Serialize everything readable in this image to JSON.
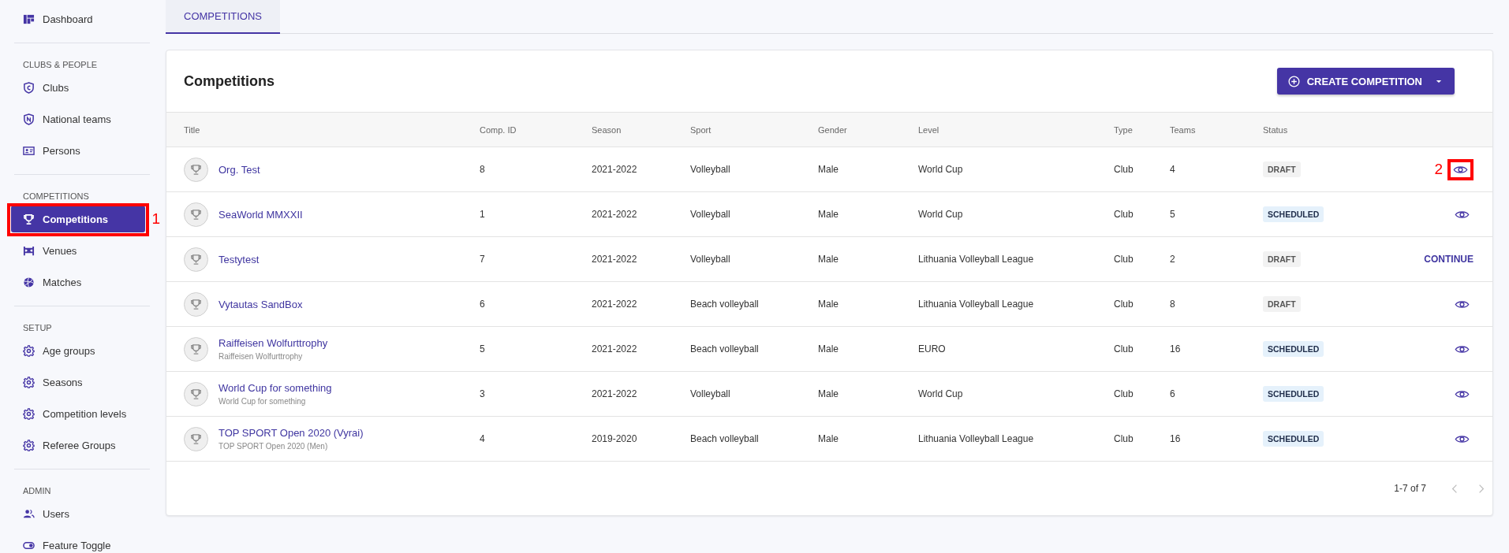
{
  "sidebar": {
    "top_items": [
      {
        "label": "Dashboard",
        "selected": false
      }
    ],
    "sections": [
      {
        "heading": "CLUBS & PEOPLE",
        "items": [
          {
            "label": "Clubs",
            "selected": false
          },
          {
            "label": "National teams",
            "selected": false
          },
          {
            "label": "Persons",
            "selected": false
          }
        ]
      },
      {
        "heading": "COMPETITIONS",
        "items": [
          {
            "label": "Competitions",
            "selected": true,
            "annotation": "1"
          },
          {
            "label": "Venues",
            "selected": false
          },
          {
            "label": "Matches",
            "selected": false
          }
        ]
      },
      {
        "heading": "SETUP",
        "items": [
          {
            "label": "Age groups",
            "selected": false
          },
          {
            "label": "Seasons",
            "selected": false
          },
          {
            "label": "Competition levels",
            "selected": false
          },
          {
            "label": "Referee Groups",
            "selected": false
          }
        ]
      },
      {
        "heading": "ADMIN",
        "items": [
          {
            "label": "Users",
            "selected": false
          },
          {
            "label": "Feature Toggle",
            "selected": false
          }
        ]
      }
    ]
  },
  "tabs": [
    {
      "label": "COMPETITIONS",
      "selected": true
    }
  ],
  "card": {
    "title": "Competitions",
    "create_button": "CREATE COMPETITION"
  },
  "table": {
    "columns": [
      "Title",
      "Comp. ID",
      "Season",
      "Sport",
      "Gender",
      "Level",
      "Type",
      "Teams",
      "Status"
    ],
    "rows": [
      {
        "title": "Org. Test",
        "comp_id": "8",
        "season": "2021-2022",
        "sport": "Volleyball",
        "gender": "Male",
        "level": "World Cup",
        "type": "Club",
        "teams": "4",
        "status": {
          "label": "DRAFT",
          "kind": "draft"
        },
        "action": {
          "kind": "view",
          "annotation": "2"
        }
      },
      {
        "title": "SeaWorld MMXXII",
        "comp_id": "1",
        "season": "2021-2022",
        "sport": "Volleyball",
        "gender": "Male",
        "level": "World Cup",
        "type": "Club",
        "teams": "5",
        "status": {
          "label": "SCHEDULED",
          "kind": "scheduled"
        },
        "action": {
          "kind": "view"
        }
      },
      {
        "title": "Testytest",
        "comp_id": "7",
        "season": "2021-2022",
        "sport": "Volleyball",
        "gender": "Male",
        "level": "Lithuania Volleyball League",
        "type": "Club",
        "teams": "2",
        "status": {
          "label": "DRAFT",
          "kind": "draft"
        },
        "action": {
          "kind": "continue",
          "label": "CONTINUE"
        }
      },
      {
        "title": "Vytautas SandBox",
        "comp_id": "6",
        "season": "2021-2022",
        "sport": "Beach volleyball",
        "gender": "Male",
        "level": "Lithuania Volleyball League",
        "type": "Club",
        "teams": "8",
        "status": {
          "label": "DRAFT",
          "kind": "draft"
        },
        "action": {
          "kind": "view"
        }
      },
      {
        "title": "Raiffeisen Wolfurttrophy",
        "subtitle": "Raiffeisen Wolfurttrophy",
        "comp_id": "5",
        "season": "2021-2022",
        "sport": "Beach volleyball",
        "gender": "Male",
        "level": "EURO",
        "type": "Club",
        "teams": "16",
        "status": {
          "label": "SCHEDULED",
          "kind": "scheduled"
        },
        "action": {
          "kind": "view"
        }
      },
      {
        "title": "World Cup for something",
        "subtitle": "World Cup for something",
        "comp_id": "3",
        "season": "2021-2022",
        "sport": "Volleyball",
        "gender": "Male",
        "level": "World Cup",
        "type": "Club",
        "teams": "6",
        "status": {
          "label": "SCHEDULED",
          "kind": "scheduled"
        },
        "action": {
          "kind": "view"
        }
      },
      {
        "title": "TOP SPORT Open 2020 (Vyrai)",
        "subtitle": "TOP SPORT Open 2020 (Men)",
        "comp_id": "4",
        "season": "2019-2020",
        "sport": "Beach volleyball",
        "gender": "Male",
        "level": "Lithuania Volleyball League",
        "type": "Club",
        "teams": "16",
        "status": {
          "label": "SCHEDULED",
          "kind": "scheduled"
        },
        "action": {
          "kind": "view"
        }
      }
    ]
  },
  "pagination": {
    "range": "1-7 of 7"
  }
}
